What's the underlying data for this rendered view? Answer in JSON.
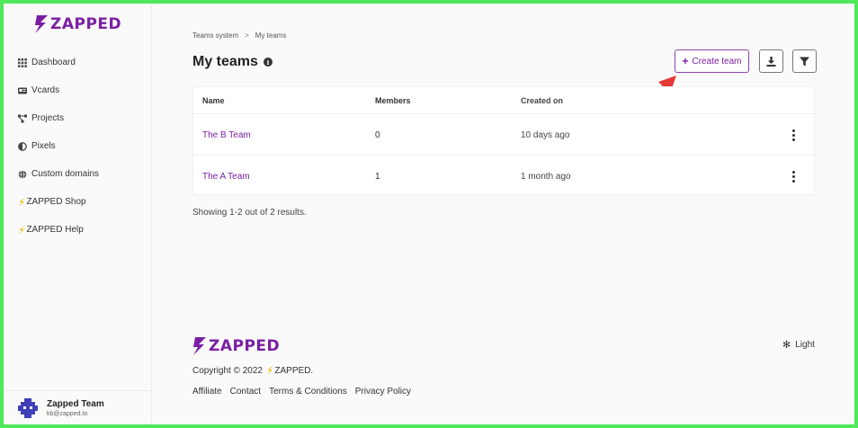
{
  "brand": {
    "name": "ZAPPED",
    "color": "#7b1fa2"
  },
  "sidebar": {
    "items": [
      {
        "label": "Dashboard",
        "icon": "grid-icon"
      },
      {
        "label": "Vcards",
        "icon": "id-card-icon"
      },
      {
        "label": "Projects",
        "icon": "project-nodes-icon"
      },
      {
        "label": "Pixels",
        "icon": "half-circle-icon"
      },
      {
        "label": "Custom domains",
        "icon": "globe-icon"
      },
      {
        "label": "ZAPPED Shop",
        "icon": "bolt-icon"
      },
      {
        "label": "ZAPPED Help",
        "icon": "bolt-icon"
      }
    ],
    "user": {
      "name": "Zapped Team",
      "email": "kb@zapped.to"
    }
  },
  "breadcrumb": {
    "parent": "Teams system",
    "separator": ">",
    "current": "My teams"
  },
  "header": {
    "title": "My teams",
    "create_label": "Create team"
  },
  "table": {
    "columns": [
      "Name",
      "Members",
      "Created on"
    ],
    "rows": [
      {
        "name": "The B Team",
        "members": "0",
        "created": "10 days ago"
      },
      {
        "name": "The A Team",
        "members": "1",
        "created": "1 month ago"
      }
    ]
  },
  "summary": "Showing 1-2 out of 2 results.",
  "footer": {
    "copyright_prefix": "Copyright © 2022",
    "copyright_brand": "ZAPPED.",
    "links": [
      "Affiliate",
      "Contact",
      "Terms & Conditions",
      "Privacy Policy"
    ],
    "theme_label": "Light"
  }
}
